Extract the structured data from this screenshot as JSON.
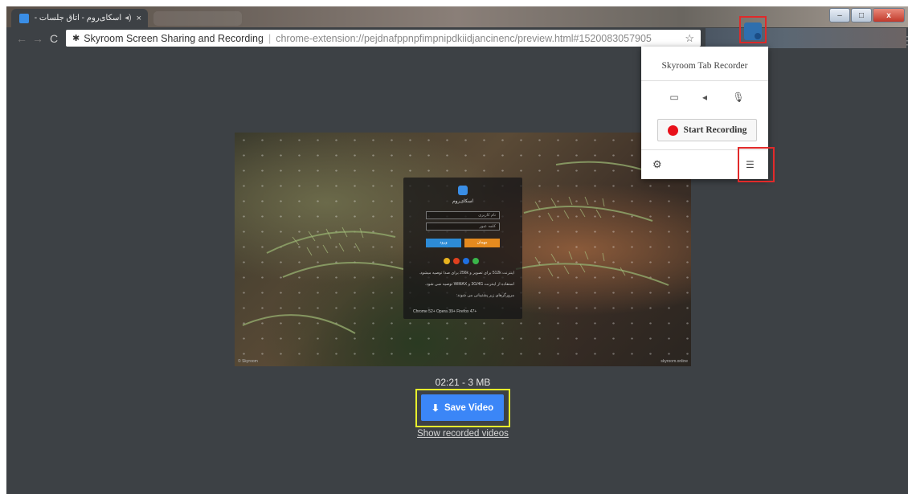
{
  "browser": {
    "tab": {
      "title": "اسکای‌روم - اتاق جلسات - ٠",
      "audio_icon": "speaker-icon",
      "close_glyph": "×"
    },
    "window_controls": {
      "minimize": "–",
      "maximize": "□",
      "close": "x"
    },
    "omnibox": {
      "extension_name": "Skyroom Screen Sharing and Recording",
      "url": "chrome-extension://pejdnafppnpfimpnipdkiidjancinenc/preview.html#1520083057905"
    },
    "highlight_color": "#e12a2a"
  },
  "video_preview": {
    "login_card": {
      "title": "اسکای‌روم",
      "username_placeholder": "نام کاربری",
      "password_placeholder": "کلمه عبور",
      "login_btn": "ورود",
      "guest_btn": "مهمان",
      "lines": [
        "اینترنت 512k برای تصویر و 256k برای صدا توصیه میشود.",
        "استفاده از اینترنت 3G/4G و WiMAX توصیه نمی شود.",
        "مرورگرهای زیر پشتیبانی می شوند:"
      ],
      "browsers": "Chrome 52+   Opera 39+   Firefox 47+"
    },
    "watermark_left": "© Skyroom",
    "watermark_right": "skyroom.online"
  },
  "recording": {
    "status": "02:21 - 3 MB",
    "save_label": "Save Video",
    "save_highlight_color": "#e7ef2c",
    "show_recorded_label": "Show recorded videos"
  },
  "popup": {
    "title": "Skyroom Tab Recorder",
    "sources": [
      "screen-icon",
      "speaker-icon",
      "microphone-icon"
    ],
    "start_label": "Start Recording",
    "settings_icon": "gear-icon",
    "list_icon": "list-icon"
  }
}
